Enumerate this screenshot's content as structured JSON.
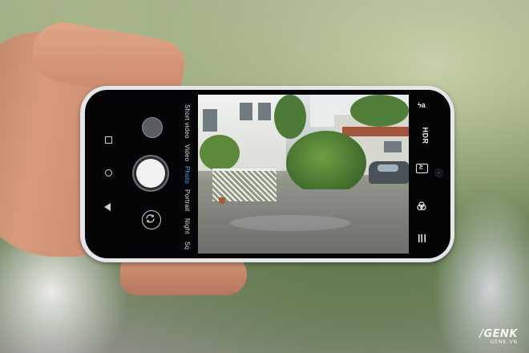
{
  "camera_ui": {
    "modes": [
      {
        "label": "Short video",
        "active": false
      },
      {
        "label": "Video",
        "active": false
      },
      {
        "label": "Photo",
        "active": true
      },
      {
        "label": "Portrait",
        "active": false
      },
      {
        "label": "Night",
        "active": false
      },
      {
        "label": "Sq",
        "active": false
      }
    ],
    "controls": {
      "flash_label": "ϟa",
      "hdr_label": "HDR",
      "ai_label": "AI"
    },
    "active_mode_color": "#4da3ff"
  },
  "watermark": {
    "brand": "GENK",
    "site": "GENK.VN"
  }
}
